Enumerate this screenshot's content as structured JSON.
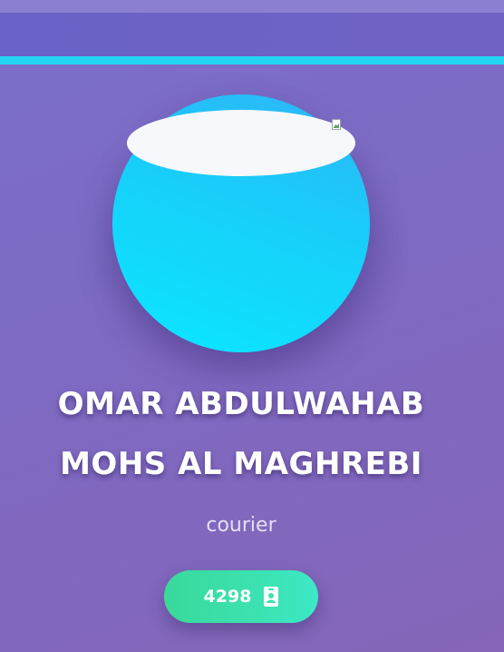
{
  "profile": {
    "name_line1": "OMAR ABDULWAHAB",
    "name_line2": "MOHS AL MAGHREBI",
    "role": "courier",
    "id_badge": {
      "number": "4298",
      "icon": "id-card-icon"
    },
    "avatar": {
      "icon": "broken-image-icon"
    }
  },
  "colors": {
    "background": "#7f69c1",
    "header": "#6a62c7",
    "accent": "#22d6f2",
    "avatar": "#17cff9",
    "badge": "#3be2b0"
  }
}
